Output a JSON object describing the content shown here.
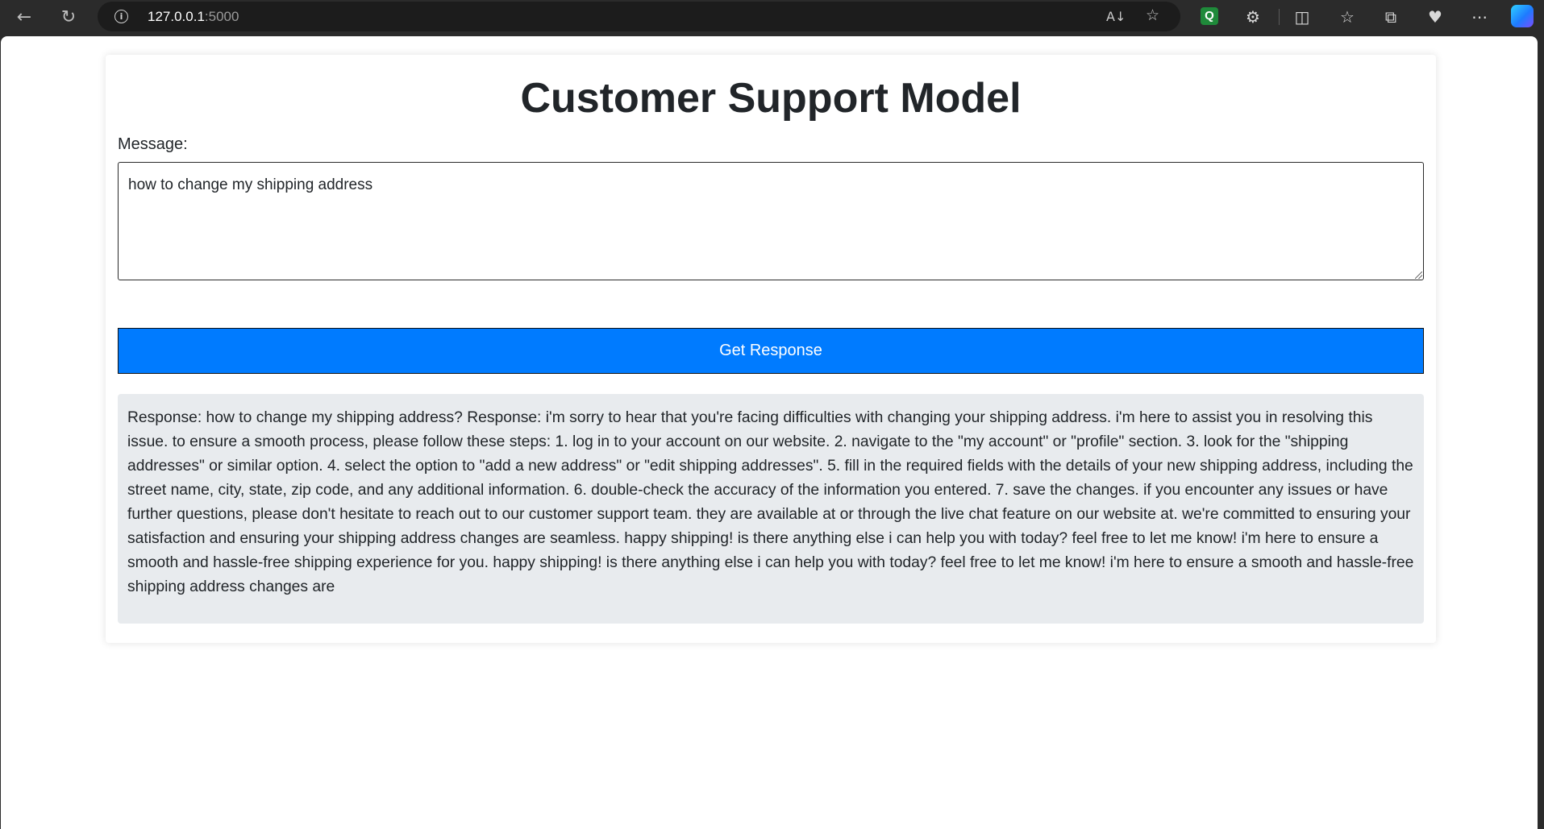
{
  "browser": {
    "url_host": "127.0.0.1",
    "url_port": ":5000",
    "icons": [
      "back-icon",
      "refresh-icon",
      "info-icon",
      "read-aloud-icon",
      "favorite-star-icon",
      "q-extension-icon",
      "extensions-icon",
      "split-screen-icon",
      "favorites-icon",
      "collections-icon",
      "browser-essentials-icon",
      "more-icon",
      "copilot-icon"
    ]
  },
  "page": {
    "title": "Customer Support Model",
    "message_label": "Message:",
    "message_value": "how to change my shipping address",
    "button_label": "Get Response",
    "response_text": "Response: how to change my shipping address? Response: i'm sorry to hear that you're facing difficulties with changing your shipping address. i'm here to assist you in resolving this issue. to ensure a smooth process, please follow these steps: 1. log in to your account on our website. 2. navigate to the \"my account\" or \"profile\" section. 3. look for the \"shipping addresses\" or similar option. 4. select the option to \"add a new address\" or \"edit shipping addresses\". 5. fill in the required fields with the details of your new shipping address, including the street name, city, state, zip code, and any additional information. 6. double-check the accuracy of the information you entered. 7. save the changes. if you encounter any issues or have further questions, please don't hesitate to reach out to our customer support team. they are available at or through the live chat feature on our website at. we're committed to ensuring your satisfaction and ensuring your shipping address changes are seamless. happy shipping! is there anything else i can help you with today? feel free to let me know! i'm here to ensure a smooth and hassle-free shipping experience for you. happy shipping! is there anything else i can help you with today? feel free to let me know! i'm here to ensure a smooth and hassle-free shipping address changes are"
  },
  "colors": {
    "button": "#007bff",
    "response_bg": "#e8ebee",
    "browser_chrome": "#2b2b2b"
  }
}
